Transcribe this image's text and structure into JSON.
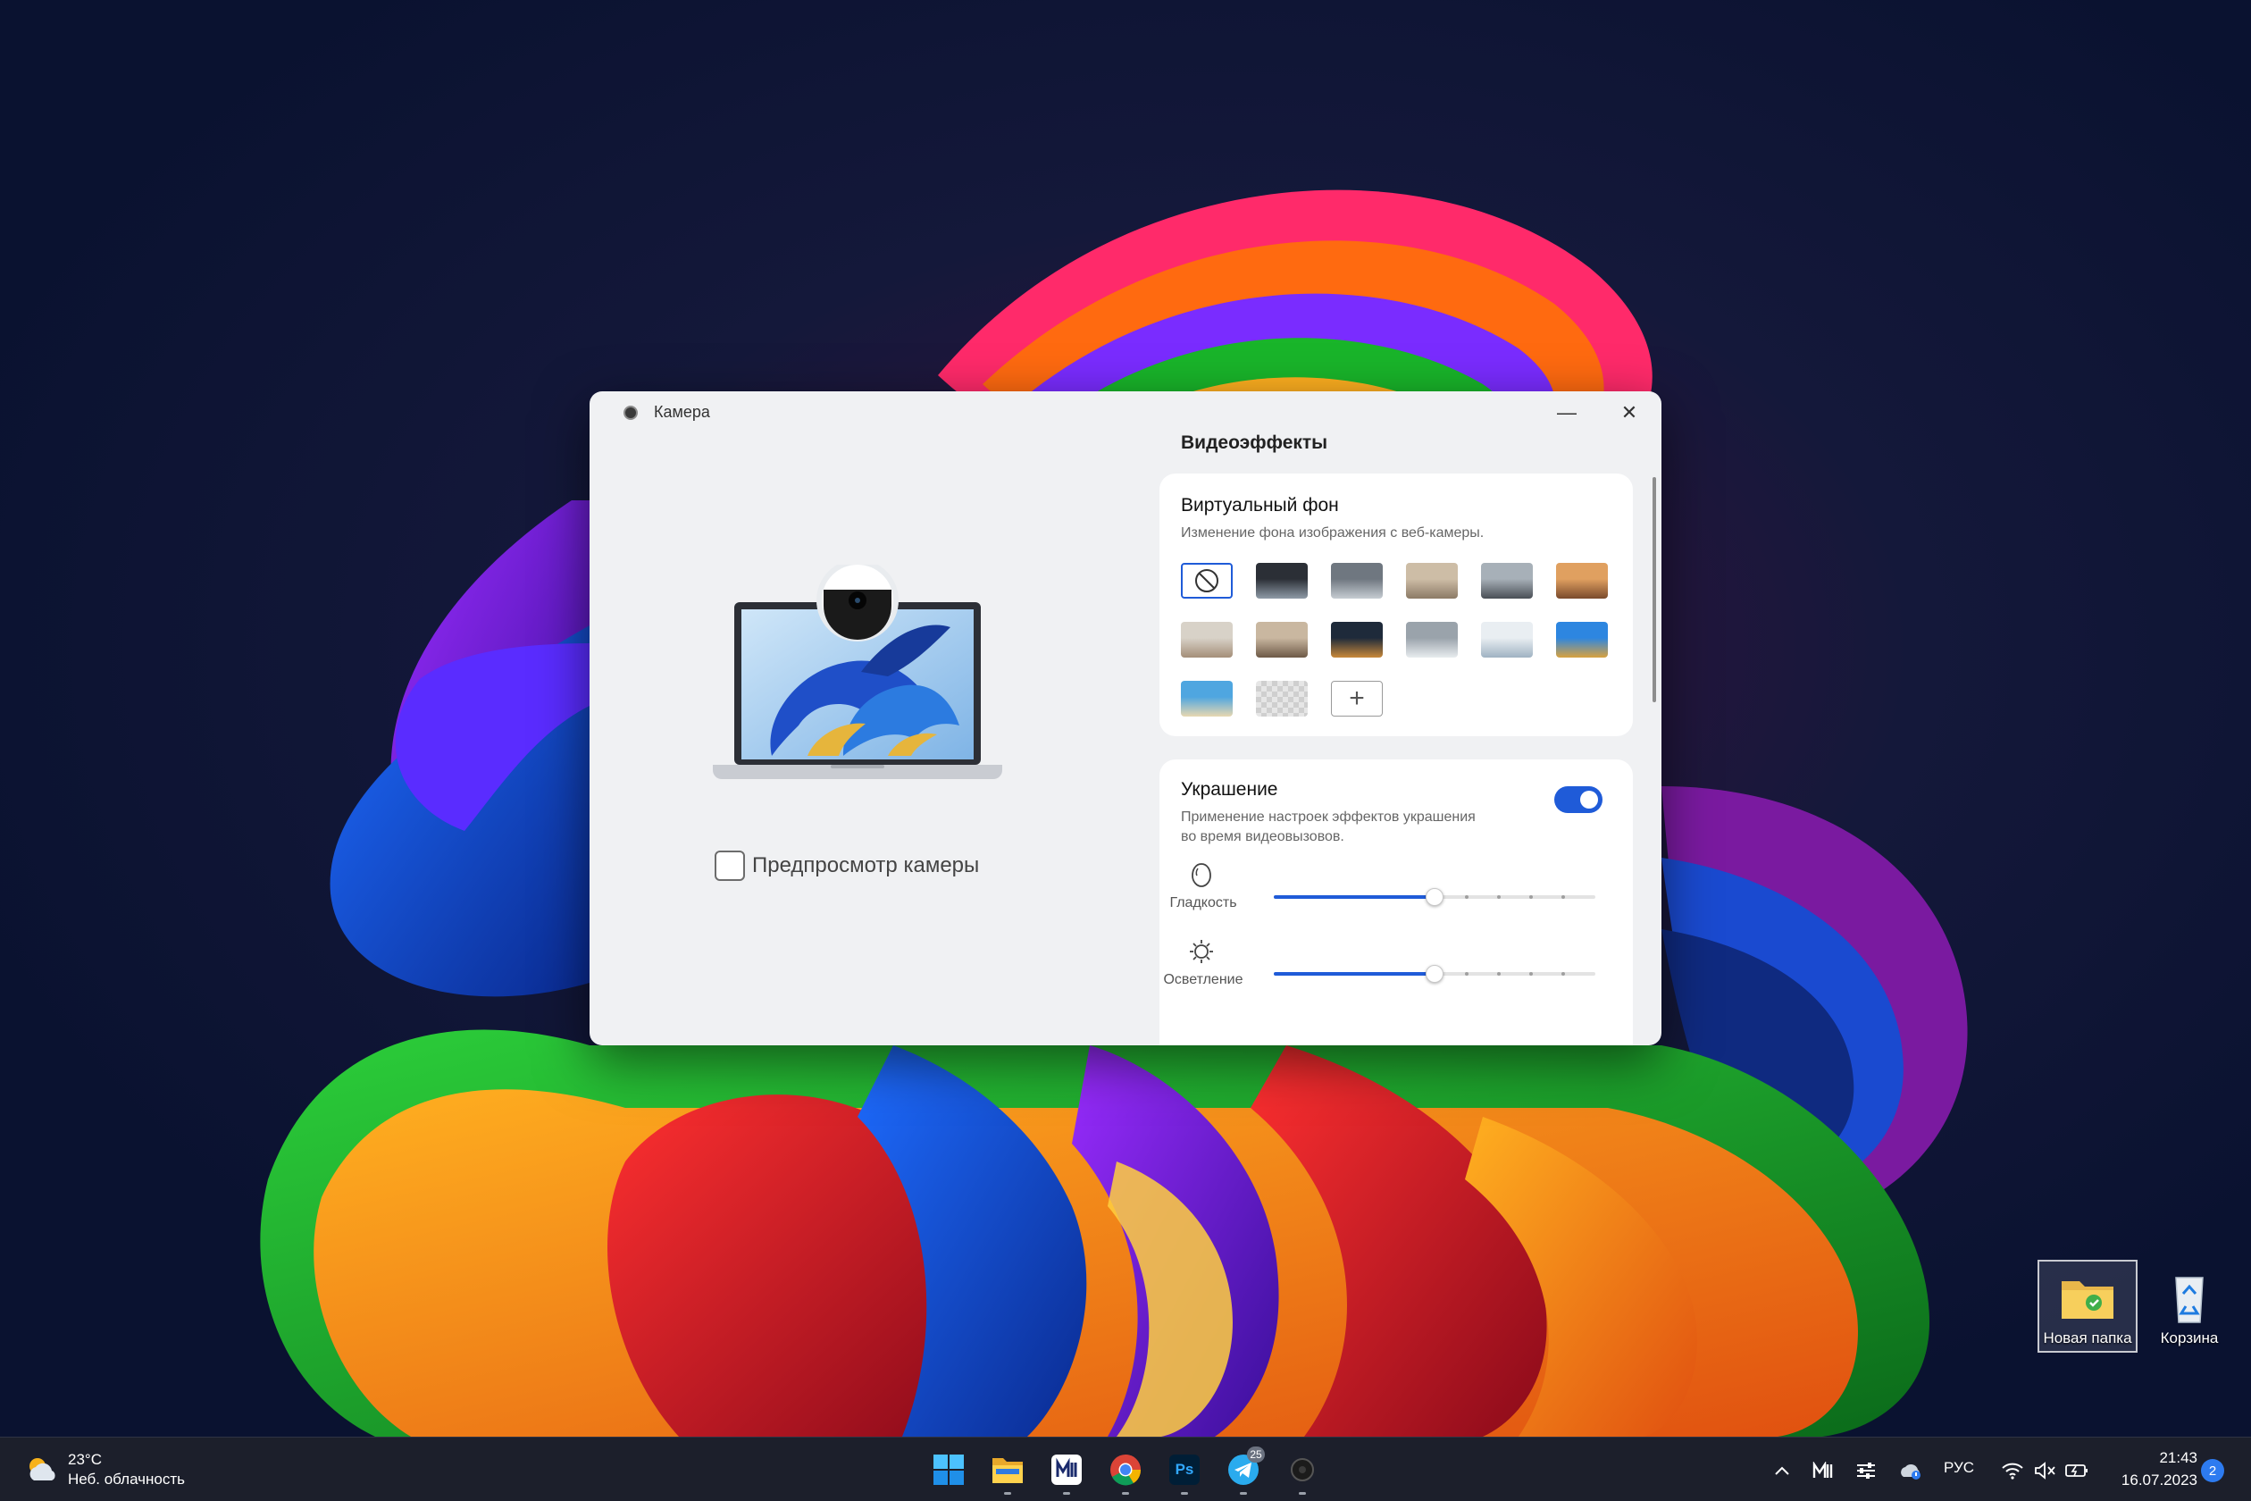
{
  "window": {
    "title": "Камера",
    "minimize_glyph": "—",
    "close_glyph": "✕"
  },
  "preview": {
    "checkbox_label": "Предпросмотр камеры",
    "checked": false
  },
  "effects": {
    "heading": "Видеоэффекты",
    "virtual_background": {
      "title": "Виртуальный фон",
      "description": "Изменение фона изображения с веб-камеры.",
      "backgrounds": [
        {
          "name": "none",
          "selected": true
        },
        {
          "name": "office-dark",
          "colors": [
            "#2b2f36",
            "#8e9aa6"
          ]
        },
        {
          "name": "office-grey",
          "colors": [
            "#6f7780",
            "#c6ccd2"
          ]
        },
        {
          "name": "living-room-beige",
          "colors": [
            "#cdbda6",
            "#8b7a66"
          ]
        },
        {
          "name": "office-window",
          "colors": [
            "#a7b0b8",
            "#4a4f56"
          ]
        },
        {
          "name": "lounge-orange",
          "colors": [
            "#e0a060",
            "#7a4a2c"
          ]
        },
        {
          "name": "bedroom-light",
          "colors": [
            "#d8d2c8",
            "#a48e78"
          ]
        },
        {
          "name": "living-room-warm",
          "colors": [
            "#c9b7a0",
            "#6e5a47"
          ]
        },
        {
          "name": "city-night",
          "colors": [
            "#1e2a3a",
            "#c9893a"
          ]
        },
        {
          "name": "studio-light",
          "colors": [
            "#9aa3ab",
            "#e8ecef"
          ]
        },
        {
          "name": "snow-landscape",
          "colors": [
            "#e9eef2",
            "#9fb2c2"
          ]
        },
        {
          "name": "blue-abstract",
          "colors": [
            "#2d86e0",
            "#d9a23e"
          ]
        },
        {
          "name": "beach",
          "colors": [
            "#4fa6e0",
            "#e8d8b0"
          ]
        },
        {
          "name": "transparent",
          "checker": true
        },
        {
          "name": "add",
          "glyph": "+"
        }
      ]
    },
    "beauty": {
      "title": "Украшение",
      "description_line1": "Применение настроек эффектов украшения",
      "description_line2": "во время видеовызовов.",
      "enabled": true,
      "sliders": [
        {
          "label": "Гладкость",
          "icon": "smoothness-icon",
          "value": 0.5
        },
        {
          "label": "Осветление",
          "icon": "brightness-icon",
          "value": 0.5
        }
      ]
    }
  },
  "desktop": {
    "icons": [
      {
        "label": "Новая папка",
        "icon": "folder-icon",
        "selected": true
      },
      {
        "label": "Корзина",
        "icon": "recycle-bin-icon",
        "selected": false
      }
    ]
  },
  "taskbar": {
    "weather": {
      "temp": "23°C",
      "condition": "Неб. облачность"
    },
    "apps": [
      "start-icon",
      "file-explorer-icon",
      "media-app-icon",
      "chrome-icon",
      "photoshop-icon",
      "telegram-icon",
      "camera-app-icon"
    ],
    "telegram_badge": "25",
    "photoshop_label": "Ps",
    "tray": {
      "language": "РУС"
    },
    "clock": {
      "time": "21:43",
      "date": "16.07.2023"
    },
    "notifications": "2"
  },
  "colors": {
    "accent": "#1f5bd8",
    "window_bg": "#f0f1f3",
    "taskbar_bg": "#1c1f2b"
  }
}
